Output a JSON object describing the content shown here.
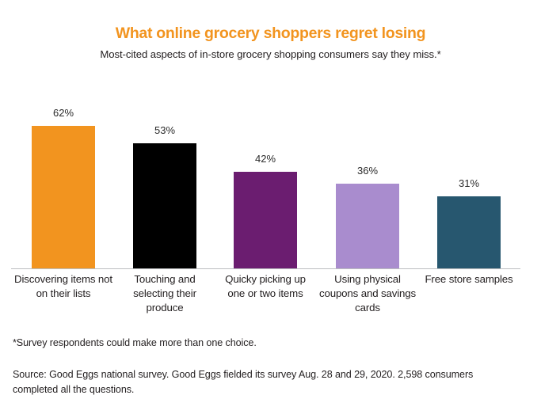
{
  "header": {
    "title": "What online grocery shoppers regret losing",
    "subtitle": "Most-cited aspects of in-store grocery shopping consumers say they miss.*"
  },
  "footnote": "*Survey respondents could make more than one choice.",
  "source": "Source:  Good Eggs national survey.  Good Eggs fielded its survey Aug. 28 and 29, 2020. 2,598 consumers completed all the questions.",
  "labels": {
    "value_0": "62%",
    "value_1": "53%",
    "value_2": "42%",
    "value_3": "36%",
    "value_4": "31%",
    "cat_0": "Discovering items not on their lists",
    "cat_1": "Touching and selecting their produce",
    "cat_2": "Quicky picking up one or two items",
    "cat_3": "Using physical coupons and savings cards",
    "cat_4": "Free store samples"
  },
  "chart_data": {
    "type": "bar",
    "title": "What online grocery shoppers regret losing",
    "subtitle": "Most-cited aspects of in-store grocery shopping consumers say they miss.*",
    "xlabel": "",
    "ylabel": "",
    "ylim": [
      0,
      70
    ],
    "grid": false,
    "legend": "none",
    "value_suffix": "%",
    "categories": [
      "Discovering items not on their lists",
      "Touching and selecting their produce",
      "Quicky picking up one or two items",
      "Using physical coupons and savings cards",
      "Free store samples"
    ],
    "values": [
      62,
      53,
      42,
      36,
      31
    ],
    "value_labels": [
      "62%",
      "53%",
      "42%",
      "36%",
      "31%"
    ],
    "colors": [
      "#F2941F",
      "#000000",
      "#6B1D70",
      "#A98CCE",
      "#27576F"
    ],
    "annotations": [
      "*Survey respondents could make more than one choice.",
      "Source:  Good Eggs national survey.  Good Eggs fielded its survey Aug. 28 and 29, 2020. 2,598 consumers completed all the questions."
    ]
  }
}
